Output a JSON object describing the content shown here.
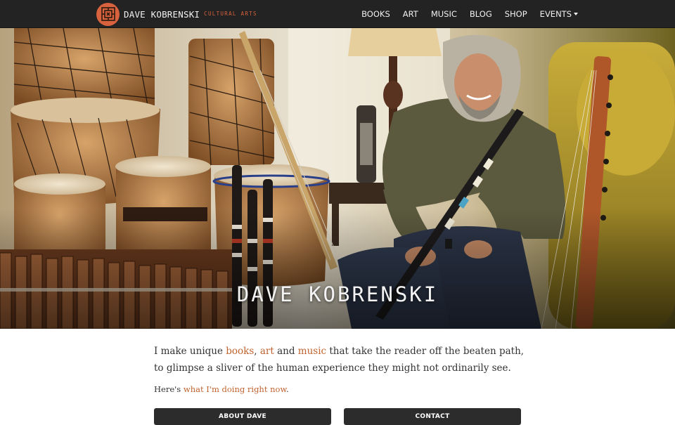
{
  "header": {
    "brand_name": "DAVE KOBRENSKI",
    "brand_tagline": "CULTURAL ARTS",
    "logo_icon": "celtic-knot-icon",
    "menu": [
      {
        "label": "BOOKS"
      },
      {
        "label": "ART"
      },
      {
        "label": "MUSIC"
      },
      {
        "label": "BLOG"
      },
      {
        "label": "SHOP"
      },
      {
        "label": "EVENTS",
        "has_dropdown": true
      }
    ]
  },
  "hero": {
    "title": "DAVE KOBRENSKI"
  },
  "intro": {
    "part1": "I make unique ",
    "link_books": "books",
    "sep1": ", ",
    "link_art": "art",
    "sep2": " and ",
    "link_music": "music",
    "part2": " that take the reader off the beaten path, to glimpse a sliver of the human experience they might not ordinarily see."
  },
  "now": {
    "prefix": "Here's ",
    "link": "what I'm doing right now",
    "suffix": "."
  },
  "buttons": {
    "about": "ABOUT DAVE",
    "contact": "CONTACT"
  },
  "colors": {
    "accent": "#d8623d",
    "link": "#c0632f",
    "navbar": "#232323",
    "button": "#2c2c2c"
  }
}
